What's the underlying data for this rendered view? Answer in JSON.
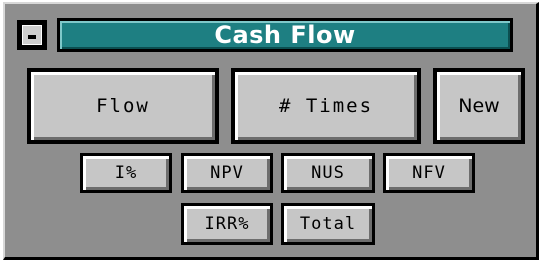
{
  "window": {
    "title": "Cash Flow"
  },
  "buttons": {
    "flow": "Flow",
    "times": "# Times",
    "new": "New",
    "i_percent": "I%",
    "npv": "NPV",
    "nus": "NUS",
    "nfv": "NFV",
    "irr_percent": "IRR%",
    "total": "Total"
  },
  "colors": {
    "title_bar": "#1e7f82",
    "window_bg": "#8e8e8e",
    "button_face": "#c6c6c6"
  }
}
